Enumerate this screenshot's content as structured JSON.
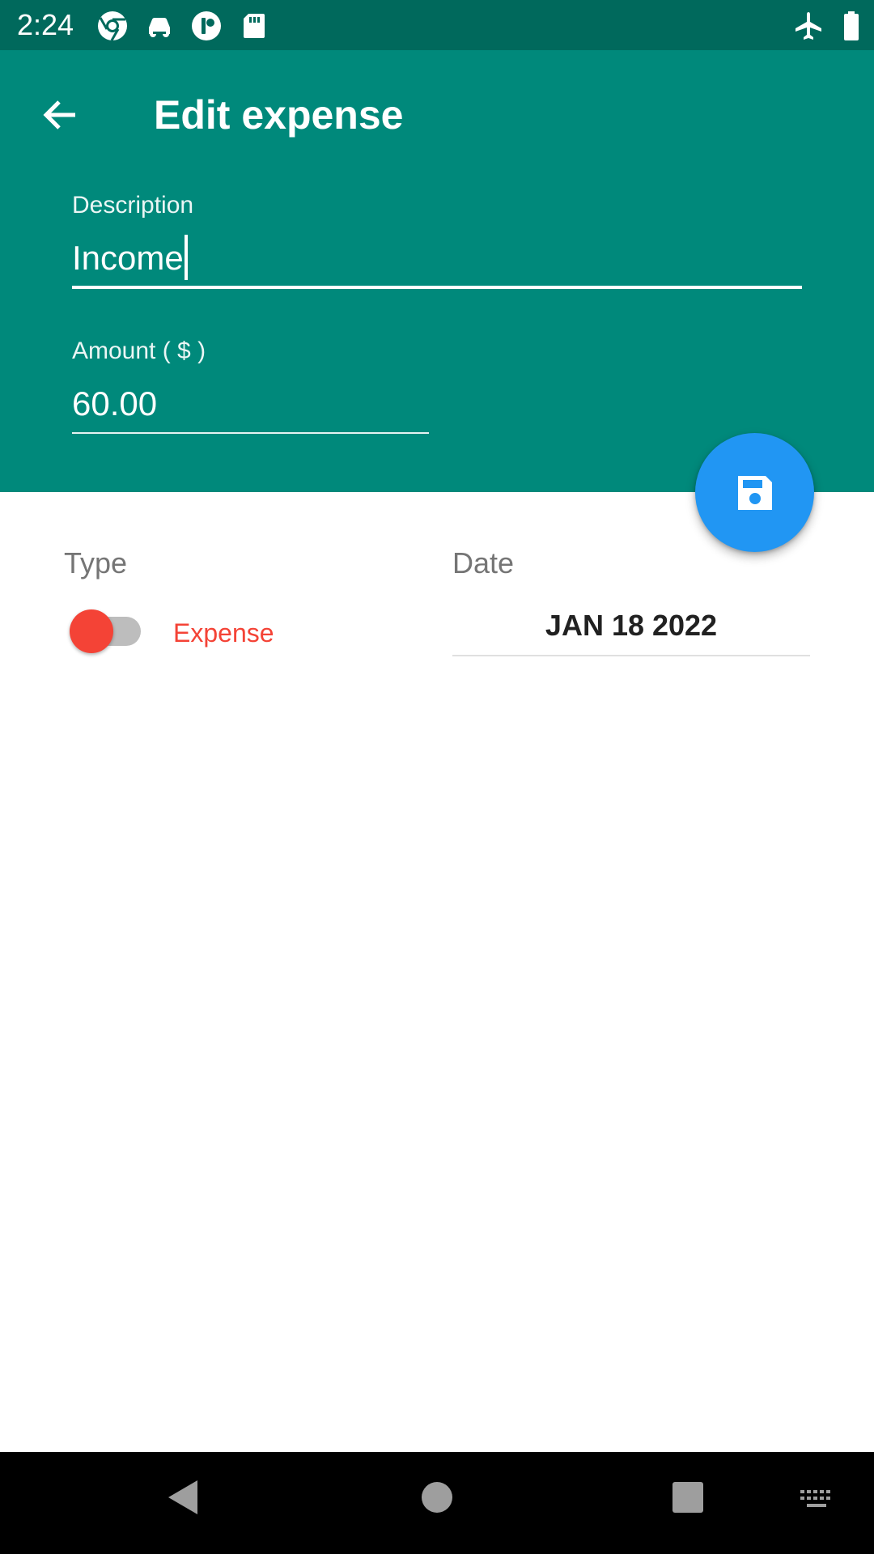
{
  "status_bar": {
    "time": "2:24",
    "icons": [
      "chrome-icon",
      "car-icon",
      "circle-app-icon",
      "sd-card-icon",
      "airplane-mode-icon",
      "battery-icon"
    ]
  },
  "header": {
    "title": "Edit expense",
    "back_icon": "arrow-left-icon",
    "description_label": "Description",
    "description_value": "Income",
    "amount_label": "Amount ( $ )",
    "amount_value": "60.00"
  },
  "fab": {
    "icon": "save-icon"
  },
  "content": {
    "type_label": "Type",
    "type_value": "Expense",
    "type_toggle_on": false,
    "date_label": "Date",
    "date_value": "JAN 18 2022"
  },
  "nav_bar": {
    "icons": [
      "back-triangle-icon",
      "home-circle-icon",
      "recents-square-icon",
      "keyboard-icon"
    ]
  },
  "colors": {
    "status_bar": "#00695c",
    "primary": "#00897b",
    "accent": "#2196f3",
    "expense_red": "#f44336",
    "label_grey": "#757575"
  }
}
